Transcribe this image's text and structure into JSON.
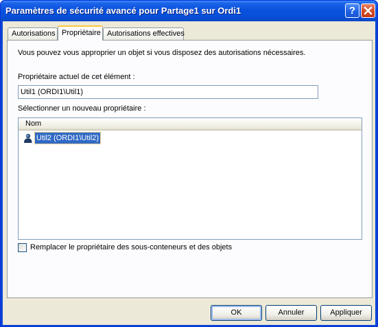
{
  "window": {
    "title": "Paramètres de sécurité avancé pour Partage1 sur Ordi1",
    "help_label": "?",
    "close_label": "✕"
  },
  "tabs": [
    {
      "label": "Autorisations",
      "active": false
    },
    {
      "label": "Propriétaire",
      "active": true
    },
    {
      "label": "Autorisations effectives",
      "active": false
    }
  ],
  "owner_tab": {
    "description": "Vous pouvez vous approprier un objet si vous disposez des autorisations nécessaires.",
    "current_owner_label": "Propriétaire actuel de cet élément :",
    "current_owner_value": "Util1 (ORDI1\\Util1)",
    "new_owner_label": "Sélectionner un nouveau propriétaire :",
    "list": {
      "column_header": "Nom",
      "items": [
        {
          "name": "Util2 (ORDI1\\Util2)",
          "icon": "user-icon",
          "selected": true
        }
      ]
    },
    "replace_checkbox": {
      "label": "Remplacer le propriétaire des sous-conteneurs et des objets",
      "checked": false
    }
  },
  "buttons": {
    "ok": "OK",
    "cancel": "Annuler",
    "apply": "Appliquer"
  },
  "colors": {
    "titlebar": "#0a52dd",
    "selection": "#316ac5",
    "dialog_bg": "#ece9d8",
    "active_tab_accent": "#ffc73c"
  }
}
